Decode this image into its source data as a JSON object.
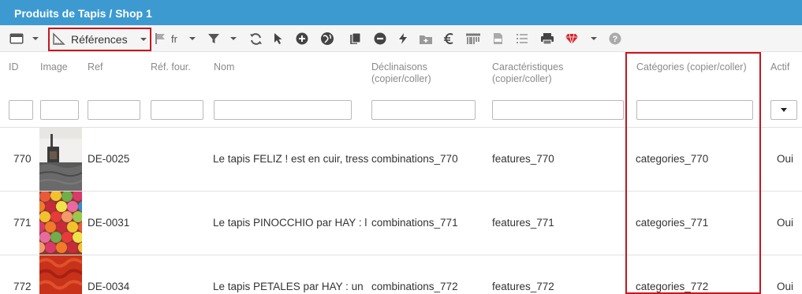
{
  "window": {
    "title": "Produits de Tapis / Shop 1"
  },
  "toolbar": {
    "view_selector": "Références",
    "language": "fr",
    "icons": [
      "grid-icon",
      "refresh-icon",
      "cursor-icon",
      "add-icon",
      "earth-icon",
      "copy-icon",
      "delete-icon",
      "flash-icon",
      "folder-add-icon",
      "euro-icon",
      "barcode-icon",
      "csv-icon",
      "list-icon",
      "print-icon",
      "diamond-icon",
      "help-icon"
    ]
  },
  "columns": {
    "id": "ID",
    "image": "Image",
    "ref": "Ref",
    "supplier_ref": "Réf. four.",
    "name": "Nom",
    "combinations_l1": "Déclinaisons",
    "combinations_l2": "(copier/coller)",
    "features_l1": "Caractéristiques",
    "features_l2": "(copier/coller)",
    "categories": "Catégories (copier/coller)",
    "active": "Actif"
  },
  "rows": [
    {
      "id": "770",
      "ref": "DE-0025",
      "name": "Le tapis FELIZ ! est en cuir, tress",
      "combinations": "combinations_770",
      "features": "features_770",
      "categories": "categories_770",
      "active": "Oui"
    },
    {
      "id": "771",
      "ref": "DE-0031",
      "name": "Le tapis PINOCCHIO par HAY : l",
      "combinations": "combinations_771",
      "features": "features_771",
      "categories": "categories_771",
      "active": "Oui"
    },
    {
      "id": "772",
      "ref": "DE-0034",
      "name": "Le tapis PETALES par HAY : un ",
      "combinations": "combinations_772",
      "features": "features_772",
      "categories": "categories_772",
      "active": "Oui"
    }
  ],
  "colors": {
    "titlebar": "#3d9ad1",
    "highlight": "#c7161d"
  }
}
